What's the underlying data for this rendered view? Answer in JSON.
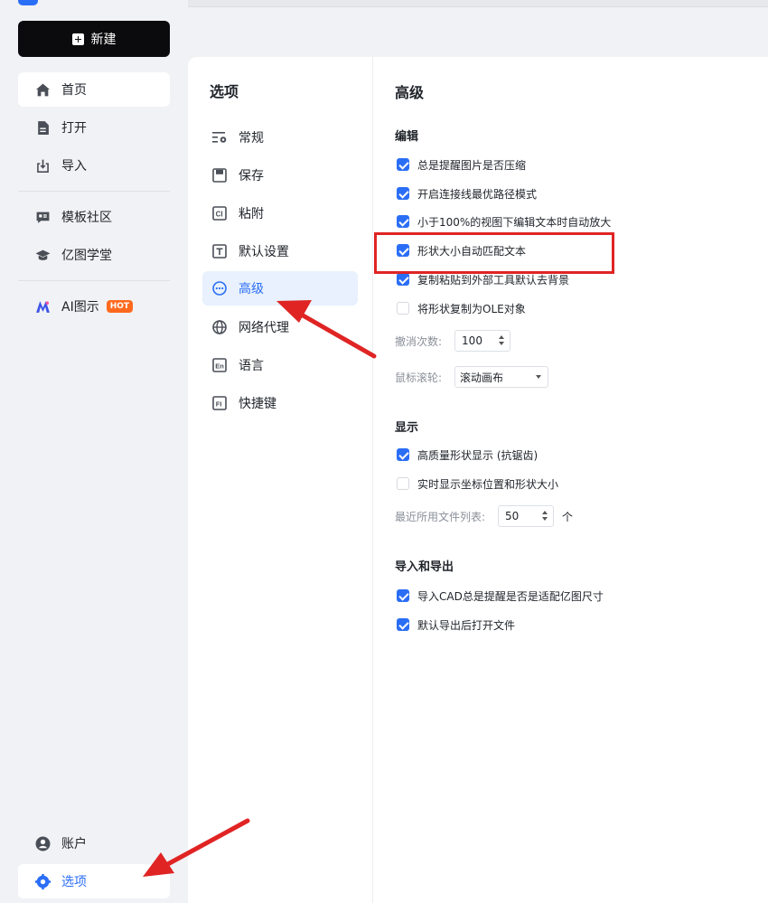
{
  "colors": {
    "accent": "#2b6ef6",
    "hot": "#ff6a1f",
    "highlight": "#e02424"
  },
  "sidebar": {
    "new_label": "新建",
    "items_top": [
      {
        "label": "首页",
        "icon": "home-icon"
      },
      {
        "label": "打开",
        "icon": "file-icon"
      },
      {
        "label": "导入",
        "icon": "import-icon"
      }
    ],
    "items_mid": [
      {
        "label": "模板社区",
        "icon": "community-icon"
      },
      {
        "label": "亿图学堂",
        "icon": "graduation-icon"
      }
    ],
    "ai": {
      "label": "AI图示",
      "badge": "HOT"
    },
    "account": "账户",
    "options": "选项"
  },
  "options_panel": {
    "title": "选项",
    "items": [
      {
        "label": "常规",
        "icon": "general-icon"
      },
      {
        "label": "保存",
        "icon": "save-icon"
      },
      {
        "label": "粘附",
        "icon": "snap-icon"
      },
      {
        "label": "默认设置",
        "icon": "text-icon"
      },
      {
        "label": "高级",
        "icon": "more-icon"
      },
      {
        "label": "网络代理",
        "icon": "globe-icon"
      },
      {
        "label": "语言",
        "icon": "language-icon"
      },
      {
        "label": "快捷键",
        "icon": "shortcut-icon"
      }
    ]
  },
  "advanced": {
    "title": "高级",
    "edit": {
      "title": "编辑",
      "checks": [
        {
          "label": "总是提醒图片是否压缩",
          "checked": true
        },
        {
          "label": "开启连接线最优路径模式",
          "checked": true
        },
        {
          "label": "小于100%的视图下编辑文本时自动放大",
          "checked": true
        },
        {
          "label": "形状大小自动匹配文本",
          "checked": true
        },
        {
          "label": "复制粘贴到外部工具默认去背景",
          "checked": true
        },
        {
          "label": "将形状复制为OLE对象",
          "checked": false
        }
      ],
      "undo_label": "撤消次数:",
      "undo_value": "100",
      "wheel_label": "鼠标滚轮:",
      "wheel_value": "滚动画布"
    },
    "display": {
      "title": "显示",
      "checks": [
        {
          "label": "高质量形状显示 (抗锯齿)",
          "checked": true
        },
        {
          "label": "实时显示坐标位置和形状大小",
          "checked": false
        }
      ],
      "recent_label": "最近所用文件列表:",
      "recent_value": "50",
      "recent_unit": "个"
    },
    "import_export": {
      "title": "导入和导出",
      "checks": [
        {
          "label": "导入CAD总是提醒是否是适配亿图尺寸",
          "checked": true
        },
        {
          "label": "默认导出后打开文件",
          "checked": true
        }
      ]
    }
  }
}
